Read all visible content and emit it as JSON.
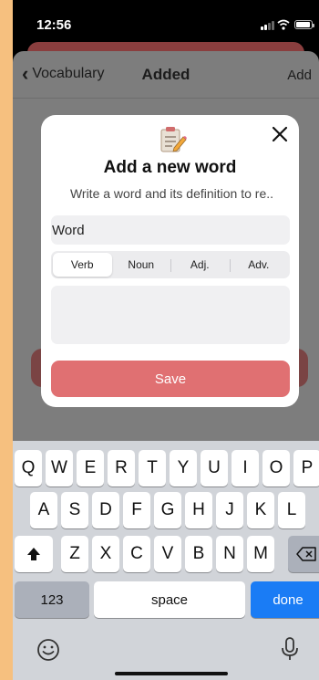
{
  "status_bar": {
    "time": "12:56"
  },
  "nav": {
    "back_label": "Vocabulary",
    "title": "Added",
    "add_label": "Add"
  },
  "modal": {
    "title": "Add a new word",
    "subtitle": "Write a word and its definition to re..",
    "word_placeholder": "Word",
    "segments": [
      "Verb",
      "Noun",
      "Adj.",
      "Adv."
    ],
    "selected_segment": "Verb",
    "save_label": "Save"
  },
  "keyboard": {
    "row1": [
      "Q",
      "W",
      "E",
      "R",
      "T",
      "Y",
      "U",
      "I",
      "O",
      "P"
    ],
    "row2": [
      "A",
      "S",
      "D",
      "F",
      "G",
      "H",
      "J",
      "K",
      "L"
    ],
    "row3": [
      "Z",
      "X",
      "C",
      "V",
      "B",
      "N",
      "M"
    ],
    "numbers_label": "123",
    "space_label": "space",
    "done_label": "done"
  },
  "colors": {
    "accent": "#e07072",
    "background": "#f6c07f",
    "done": "#1a7cf5"
  },
  "icons": [
    "notepad-icon",
    "close-icon",
    "chevron-left-icon",
    "shift-icon",
    "backspace-icon",
    "emoji-icon",
    "microphone-icon"
  ]
}
